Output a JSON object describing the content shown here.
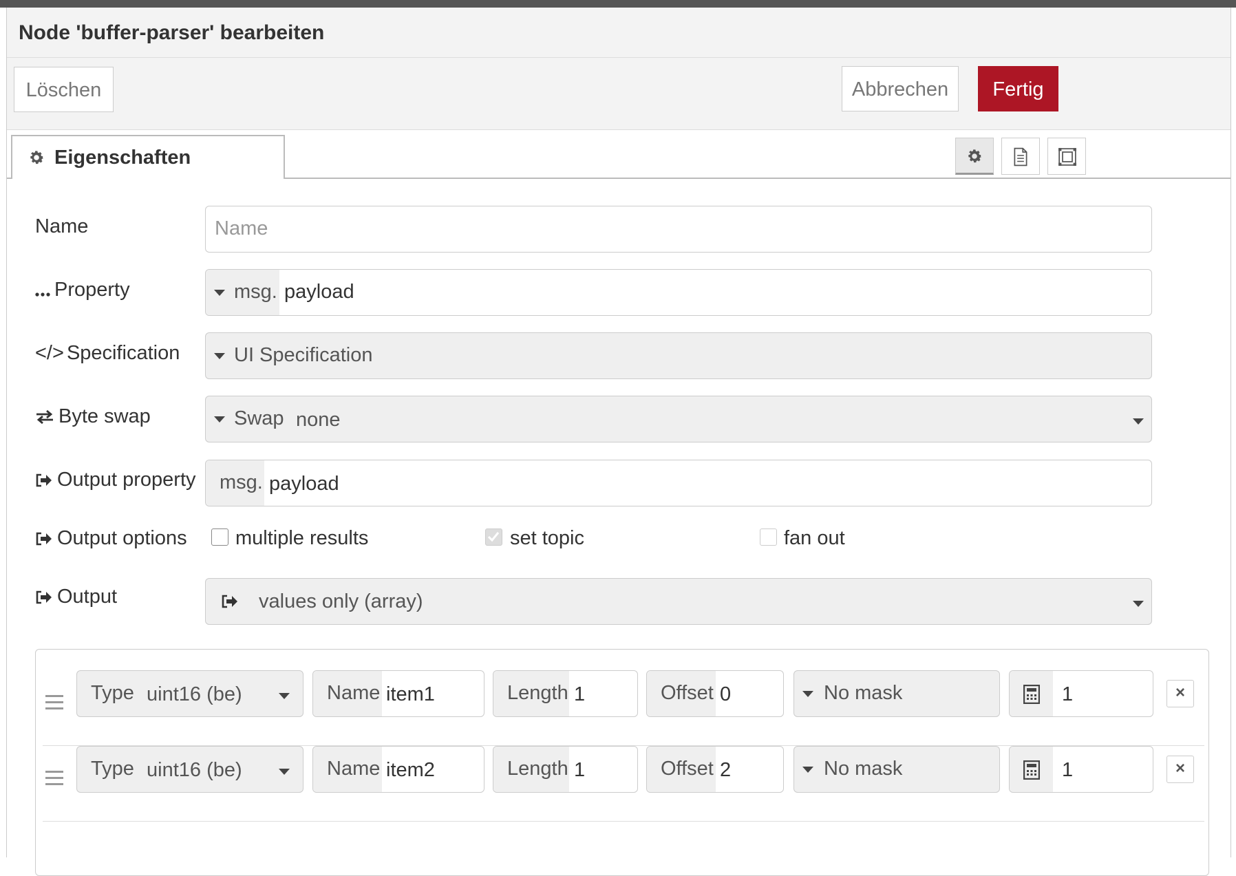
{
  "dialog": {
    "title": "Node 'buffer-parser' bearbeiten",
    "delete_label": "Löschen",
    "cancel_label": "Abbrechen",
    "done_label": "Fertig"
  },
  "tabs": {
    "properties_label": "Eigenschaften",
    "tool_icons": [
      "gear-icon",
      "document-icon",
      "frame-icon"
    ]
  },
  "form": {
    "name": {
      "label": "Name",
      "placeholder": "Name",
      "value": ""
    },
    "property": {
      "label": "Property",
      "prefix": "msg.",
      "value": "payload"
    },
    "specification": {
      "label": "Specification",
      "value": "UI Specification"
    },
    "byte_swap": {
      "label": "Byte swap",
      "prefix": "Swap",
      "value": "none"
    },
    "output_property": {
      "label": "Output property",
      "prefix": "msg.",
      "value": "payload"
    },
    "output_options": {
      "label": "Output options",
      "options": [
        {
          "label": "multiple results",
          "checked": false,
          "disabled": false
        },
        {
          "label": "set topic",
          "checked": true,
          "disabled": true
        },
        {
          "label": "fan out",
          "checked": false,
          "disabled": true
        }
      ]
    },
    "output": {
      "label": "Output",
      "value": "values only (array)"
    }
  },
  "items": [
    {
      "type_label": "Type",
      "type": "uint16 (be)",
      "name_label": "Name",
      "name": "item1",
      "length_label": "Length",
      "length": "1",
      "offset_label": "Offset",
      "offset": "0",
      "mask": "No mask",
      "scale": "1"
    },
    {
      "type_label": "Type",
      "type": "uint16 (be)",
      "name_label": "Name",
      "name": "item2",
      "length_label": "Length",
      "length": "1",
      "offset_label": "Offset",
      "offset": "2",
      "mask": "No mask",
      "scale": "1"
    }
  ],
  "colors": {
    "primary": "#ad1625",
    "field_gray": "#efefef",
    "border": "#cccccc"
  }
}
